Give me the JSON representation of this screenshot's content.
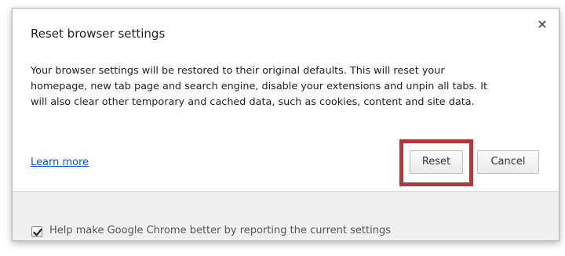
{
  "dialog": {
    "title": "Reset browser settings",
    "close_label": "×",
    "description": "Your browser settings will be restored to their original defaults. This will reset your homepage, new tab page and search engine, disable your extensions and unpin all tabs. It will also clear other temporary and cached data, such as cookies, content and site data.",
    "learn_more_label": "Learn more",
    "reset_label": "Reset",
    "cancel_label": "Cancel",
    "reset_highlight_color": "#b0393c"
  },
  "footer": {
    "feedback_checked": true,
    "feedback_label": "Help make Google Chrome better by reporting the current settings"
  },
  "icons": {
    "close": "close-icon",
    "checkmark": "checkmark-icon"
  }
}
